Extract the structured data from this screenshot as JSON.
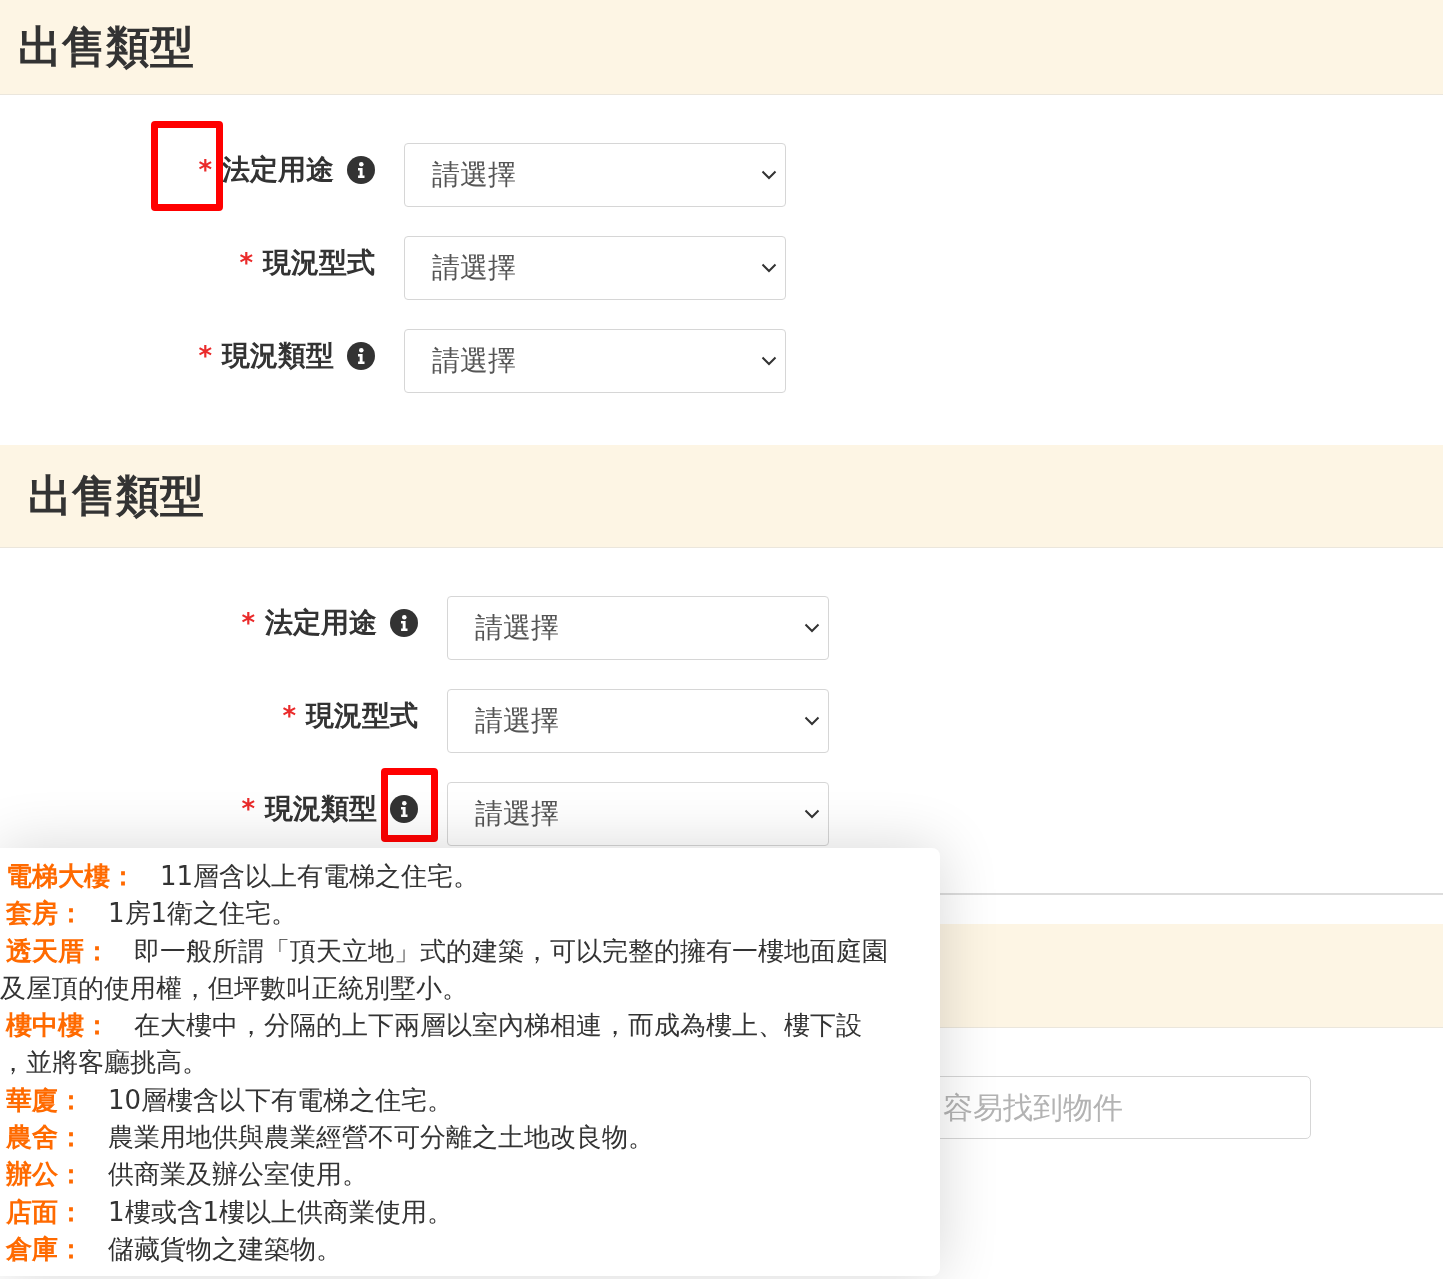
{
  "panels": [
    {
      "title": "出售類型",
      "fields": [
        {
          "asterisk": "*",
          "label": "法定用途",
          "info": true,
          "asterisk_highlighted": true,
          "info_highlighted": false,
          "value": "請選擇"
        },
        {
          "asterisk": "*",
          "label": "現況型式",
          "info": false,
          "asterisk_highlighted": false,
          "info_highlighted": false,
          "value": "請選擇"
        },
        {
          "asterisk": "*",
          "label": "現況類型",
          "info": true,
          "asterisk_highlighted": false,
          "info_highlighted": false,
          "value": "請選擇"
        }
      ]
    },
    {
      "title": "出售類型",
      "fields": [
        {
          "asterisk": "*",
          "label": "法定用途",
          "info": true,
          "asterisk_highlighted": false,
          "info_highlighted": false,
          "value": "請選擇"
        },
        {
          "asterisk": "*",
          "label": "現況型式",
          "info": false,
          "asterisk_highlighted": false,
          "info_highlighted": false,
          "value": "請選擇"
        },
        {
          "asterisk": "*",
          "label": "現況類型",
          "info": true,
          "asterisk_highlighted": false,
          "info_highlighted": true,
          "value": "請選擇"
        }
      ],
      "next_section": {
        "placeholder": "容易找到物件"
      },
      "tooltip": {
        "items": [
          {
            "term": "電梯大樓：",
            "lines": [
              "11層含以上有電梯之住宅。"
            ]
          },
          {
            "term": "套房：",
            "lines": [
              "1房1衛之住宅。"
            ]
          },
          {
            "term": "透天厝：",
            "lines": [
              "即一般所謂「頂天立地」式的建築，可以完整的擁有一樓地面庭園",
              "及屋頂的使用權，但坪數叫正統別墅小。"
            ]
          },
          {
            "term": "樓中樓：",
            "lines": [
              "在大樓中，分隔的上下兩層以室內梯相連，而成為樓上、樓下設",
              "，並將客廳挑高。"
            ]
          },
          {
            "term": "華廈：",
            "lines": [
              "10層樓含以下有電梯之住宅。"
            ]
          },
          {
            "term": "農舍：",
            "lines": [
              "農業用地供與農業經營不可分離之土地改良物。"
            ]
          },
          {
            "term": "辦公：",
            "lines": [
              "供商業及辦公室使用。"
            ]
          },
          {
            "term": "店面：",
            "lines": [
              "1樓或含1樓以上供商業使用。"
            ]
          },
          {
            "term": "倉庫：",
            "lines": [
              "儲藏貨物之建築物。"
            ]
          }
        ]
      }
    }
  ]
}
